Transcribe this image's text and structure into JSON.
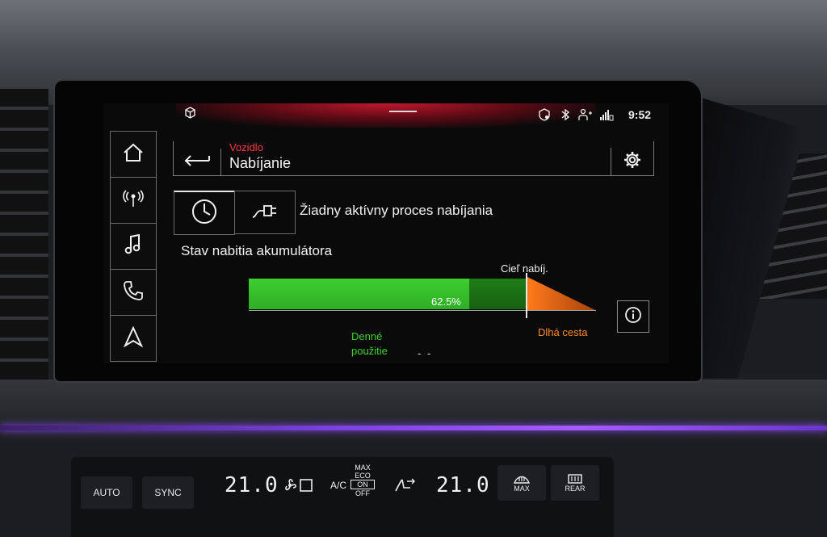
{
  "status_bar": {
    "time": "9:52"
  },
  "header": {
    "breadcrumb": "Vozidlo",
    "title": "Nabíjanie"
  },
  "nav": {
    "items": [
      "home-icon",
      "radio-icon",
      "music-icon",
      "phone-icon",
      "navigation-icon"
    ]
  },
  "charging": {
    "status_text": "Žiadny aktívny proces nabíjania",
    "battery_label": "Stav nabitia akumulátora",
    "percent_text": "62.5%",
    "level_fraction": 0.625,
    "target_label": "Cieľ nabíj.",
    "daily_use_label_line1": "Denné",
    "daily_use_label_line2": "použitie",
    "daily_use_value": "- -",
    "long_trip_label": "Dlhá cesta"
  },
  "climate": {
    "auto": "AUTO",
    "sync": "SYNC",
    "temp_left": "21.0",
    "ac": "A/C",
    "max": "MAX",
    "eco": "ECO",
    "on": "ON",
    "off": "OFF",
    "temp_right": "21.0",
    "max_defrost": "MAX",
    "rear_defrost": "REAR"
  },
  "colors": {
    "accent_red": "#ff3b3b",
    "charge_green": "#3dcf2f",
    "long_trip_orange": "#ff8a1f",
    "ambient_purple": "#8a4cff"
  }
}
